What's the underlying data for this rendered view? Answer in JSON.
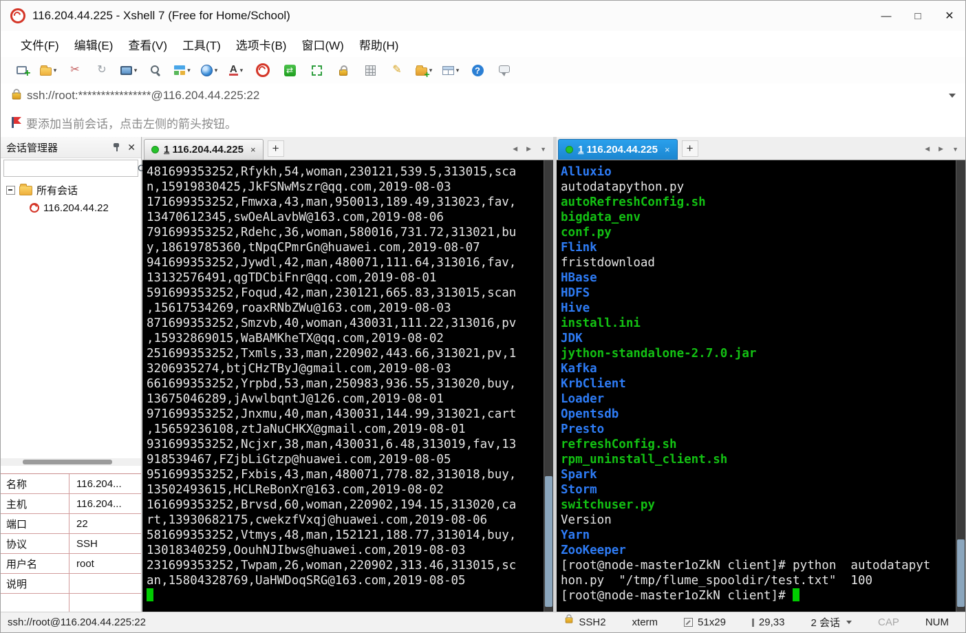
{
  "window": {
    "title": "116.204.44.225 - Xshell 7 (Free for Home/School)",
    "controls": {
      "minimize": "—",
      "maximize": "□",
      "close": "✕"
    }
  },
  "menu": {
    "items": [
      "文件(F)",
      "编辑(E)",
      "查看(V)",
      "工具(T)",
      "选项卡(B)",
      "窗口(W)",
      "帮助(H)"
    ]
  },
  "toolbar": {
    "caret_glyph": "▾",
    "icons": [
      {
        "name": "new-session-icon",
        "kind": "winplus"
      },
      {
        "name": "open-session-icon",
        "kind": "folder",
        "caret": true
      },
      {
        "name": "disconnect-icon",
        "glyph": "✂",
        "color": "#c25b5b"
      },
      {
        "name": "reconnect-icon",
        "glyph": "↻",
        "color": "#9aa0a6"
      },
      {
        "name": "session-dialog-icon",
        "kind": "monitor",
        "caret": true
      },
      {
        "name": "find-icon",
        "kind": "mag"
      },
      {
        "name": "new-layout-icon",
        "kind": "layout",
        "caret": true
      },
      {
        "name": "web-browser-icon",
        "kind": "globe",
        "caret": true
      },
      {
        "name": "font-icon",
        "kind": "font",
        "glyph": "A",
        "caret": true
      },
      {
        "name": "xshell-logo-icon",
        "kind": "spiral"
      },
      {
        "name": "xftp-icon",
        "kind": "xftp",
        "glyph": "⇄"
      },
      {
        "name": "fullscreen-icon",
        "kind": "fullscreen"
      },
      {
        "name": "lock-icon",
        "kind": "lock"
      },
      {
        "name": "keypad-icon",
        "kind": "keypad"
      },
      {
        "name": "highlight-icon",
        "glyph": "✎",
        "color": "#d7a321"
      },
      {
        "name": "new-folder-icon",
        "kind": "folderplus",
        "caret": true
      },
      {
        "name": "tile-windows-icon",
        "kind": "table",
        "caret": true
      },
      {
        "name": "help-icon",
        "kind": "help",
        "glyph": "?"
      },
      {
        "name": "feedback-icon",
        "kind": "bubble"
      }
    ]
  },
  "address_bar": {
    "value": "ssh://root:****************@116.204.44.225:22"
  },
  "info_bar": {
    "text": "要添加当前会话，点击左侧的箭头按钮。"
  },
  "session_manager": {
    "title": "会话管理器",
    "search_placeholder": "",
    "tree": {
      "root": "所有会话",
      "session": "116.204.44.22"
    },
    "properties": [
      {
        "label": "名称",
        "value": "116.204..."
      },
      {
        "label": "主机",
        "value": "116.204..."
      },
      {
        "label": "端口",
        "value": "22"
      },
      {
        "label": "协议",
        "value": "SSH"
      },
      {
        "label": "用户名",
        "value": "root"
      },
      {
        "label": "说明",
        "value": ""
      }
    ]
  },
  "tab_nav": {
    "prev": "◀",
    "next": "▶",
    "menu": "▼"
  },
  "left_pane": {
    "tab": {
      "number": "1",
      "label": "116.204.44.225",
      "close": "×"
    },
    "add_tab": "+",
    "lines": [
      "481699353252,Rfykh,54,woman,230121,539.5,313015,sca",
      "n,15919830425,JkFSNwMszr@qq.com,2019-08-03",
      "171699353252,Fmwxa,43,man,950013,189.49,313023,fav,",
      "13470612345,swOeALavbW@163.com,2019-08-06",
      "791699353252,Rdehc,36,woman,580016,731.72,313021,bu",
      "y,18619785360,tNpqCPmrGn@huawei.com,2019-08-07",
      "941699353252,Jywdl,42,man,480071,111.64,313016,fav,",
      "13132576491,qgTDCbiFnr@qq.com,2019-08-01",
      "591699353252,Foqud,42,man,230121,665.83,313015,scan",
      ",15617534269,roaxRNbZWu@163.com,2019-08-03",
      "871699353252,Smzvb,40,woman,430031,111.22,313016,pv",
      ",15932869015,WaBAMKheTX@qq.com,2019-08-02",
      "251699353252,Txmls,33,man,220902,443.66,313021,pv,1",
      "3206935274,btjCHzTByJ@gmail.com,2019-08-03",
      "661699353252,Yrpbd,53,man,250983,936.55,313020,buy,",
      "13675046289,jAvwlbqntJ@126.com,2019-08-01",
      "971699353252,Jnxmu,40,man,430031,144.99,313021,cart",
      ",15659236108,ztJaNuCHKX@gmail.com,2019-08-01",
      "931699353252,Ncjxr,38,man,430031,6.48,313019,fav,13",
      "918539467,FZjbLiGtzp@huawei.com,2019-08-05",
      "951699353252,Fxbis,43,man,480071,778.82,313018,buy,",
      "13502493615,HCLReBonXr@163.com,2019-08-02",
      "161699353252,Brvsd,60,woman,220902,194.15,313020,ca",
      "rt,13930682175,cwekzfVxqj@huawei.com,2019-08-06",
      "581699353252,Vtmys,48,man,152121,188.77,313014,buy,",
      "13018340259,OouhNJIbws@huawei.com,2019-08-03",
      "231699353252,Twpam,26,woman,220902,313.46,313015,sc",
      "an,15804328769,UaHWDoqSRG@163.com,2019-08-05"
    ]
  },
  "right_pane": {
    "tab": {
      "number": "1",
      "label": "116.204.44.225",
      "close": "×"
    },
    "add_tab": "+",
    "lines": [
      {
        "t": "Alluxio",
        "c": "blue"
      },
      {
        "t": "autodatapython.py",
        "c": "white"
      },
      {
        "t": "autoRefreshConfig.sh",
        "c": "green"
      },
      {
        "t": "bigdata_env",
        "c": "green"
      },
      {
        "t": "conf.py",
        "c": "green"
      },
      {
        "t": "Flink",
        "c": "blue"
      },
      {
        "t": "fristdownload",
        "c": "white"
      },
      {
        "t": "HBase",
        "c": "blue"
      },
      {
        "t": "HDFS",
        "c": "blue"
      },
      {
        "t": "Hive",
        "c": "blue"
      },
      {
        "t": "install.ini",
        "c": "green"
      },
      {
        "t": "JDK",
        "c": "blue"
      },
      {
        "t": "jython-standalone-2.7.0.jar",
        "c": "green"
      },
      {
        "t": "Kafka",
        "c": "blue"
      },
      {
        "t": "KrbClient",
        "c": "blue"
      },
      {
        "t": "Loader",
        "c": "blue"
      },
      {
        "t": "Opentsdb",
        "c": "blue"
      },
      {
        "t": "Presto",
        "c": "blue"
      },
      {
        "t": "refreshConfig.sh",
        "c": "green"
      },
      {
        "t": "rpm_uninstall_client.sh",
        "c": "green"
      },
      {
        "t": "Spark",
        "c": "blue"
      },
      {
        "t": "Storm",
        "c": "blue"
      },
      {
        "t": "switchuser.py",
        "c": "green"
      },
      {
        "t": "Version",
        "c": "white"
      },
      {
        "t": "Yarn",
        "c": "blue"
      },
      {
        "t": "ZooKeeper",
        "c": "blue"
      },
      {
        "t": "[root@node-master1oZkN client]# python  autodatapyt",
        "c": "white"
      },
      {
        "t": "hon.py  \"/tmp/flume_spooldir/test.txt\"  100",
        "c": "white"
      },
      {
        "t": "[root@node-master1oZkN client]# ",
        "c": "white",
        "cursor": true
      }
    ]
  },
  "status_bar": {
    "connection": "ssh://root@116.204.44.225:22",
    "encryption": "SSH2",
    "terminal_type": "xterm",
    "terminal_size": "51x29",
    "cursor_position": "29,33",
    "session_count": "2 会话",
    "caps_lock": "CAP",
    "num_lock": "NUM"
  }
}
